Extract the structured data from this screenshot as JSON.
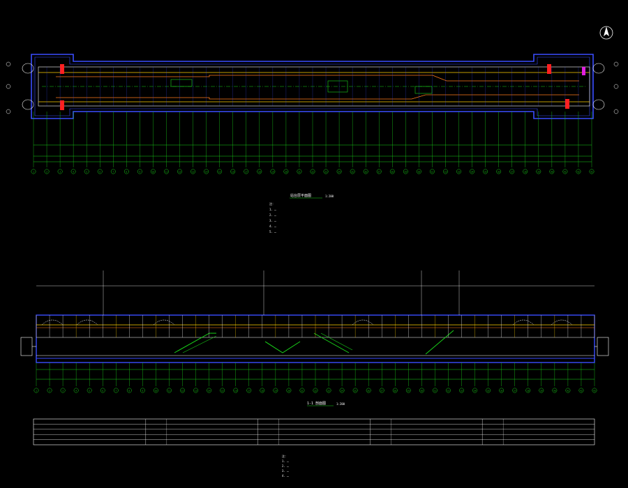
{
  "drawing": {
    "background": "#000000",
    "north_arrow_label": "N",
    "colors": {
      "outline": "#3a4dff",
      "grid": "#19d419",
      "wall": "#ffffff",
      "center_line": "#ffd000",
      "edge_line": "#ff7a1a",
      "accent_red": "#ff2020",
      "accent_magenta": "#e020e0",
      "cyan": "#20d0ff",
      "table_line": "#ffffff"
    }
  },
  "plan": {
    "title": "站台层平面图",
    "scale": "1:200",
    "axis_labels": [
      "1",
      "2",
      "3",
      "4",
      "5",
      "6",
      "7",
      "8",
      "9",
      "10",
      "11",
      "12",
      "13",
      "14",
      "15",
      "16",
      "17",
      "18",
      "19",
      "20",
      "21",
      "22",
      "23",
      "24",
      "25",
      "26",
      "27",
      "28",
      "29",
      "30",
      "31",
      "32",
      "33",
      "34",
      "35",
      "36",
      "37",
      "38",
      "39",
      "40",
      "41",
      "42",
      "43"
    ],
    "row_labels": [
      "D",
      "C",
      "B",
      "A"
    ],
    "notes": [
      "注：",
      "1. …",
      "2. …",
      "3. …",
      "4. …",
      "5. …"
    ]
  },
  "section": {
    "title": "1-1 剖面图",
    "scale": "1:200",
    "axis_labels": [
      "1",
      "2",
      "3",
      "4",
      "5",
      "6",
      "7",
      "8",
      "9",
      "10",
      "11",
      "12",
      "13",
      "14",
      "15",
      "16",
      "17",
      "18",
      "19",
      "20",
      "21",
      "22",
      "23",
      "24",
      "25",
      "26",
      "27",
      "28",
      "29",
      "30",
      "31",
      "32",
      "33",
      "34",
      "35",
      "36",
      "37",
      "38",
      "39",
      "40",
      "41",
      "42",
      "43"
    ]
  },
  "schedule_table": {
    "columns": 5,
    "rows": 5
  },
  "footer_notes": [
    "注：",
    "1. …",
    "2. …",
    "3. …",
    "4. …"
  ]
}
